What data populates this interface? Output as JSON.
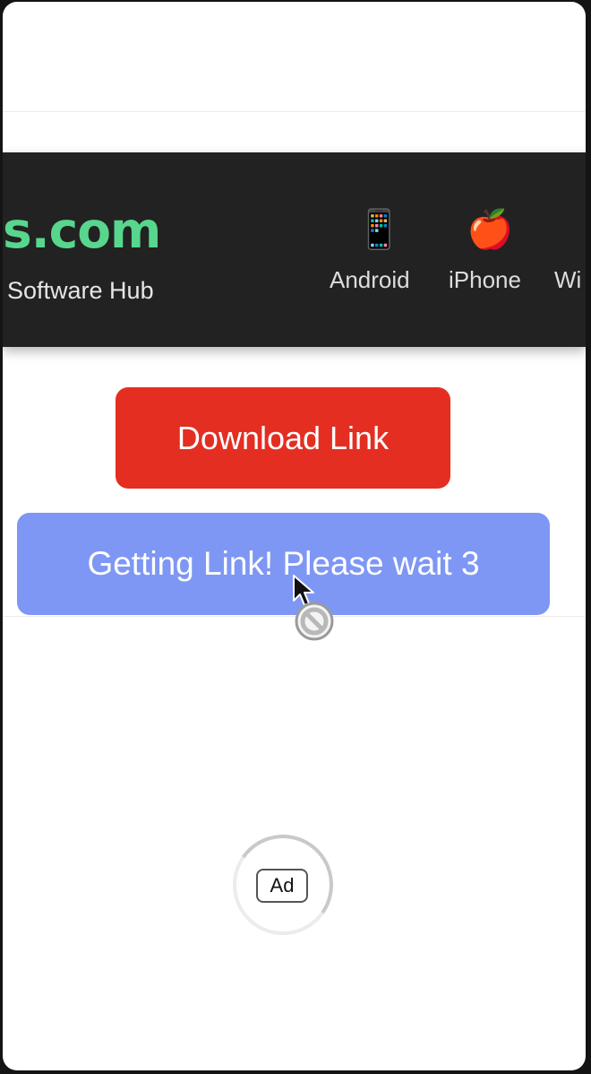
{
  "header": {
    "logo_text": "s.com",
    "tagline": "Software Hub",
    "nav": [
      {
        "icon": "mobile-phone-icon",
        "glyph": "📱",
        "label": "Android"
      },
      {
        "icon": "apple-icon",
        "glyph": "🍎",
        "label": "iPhone"
      },
      {
        "label": "Wi"
      }
    ]
  },
  "main": {
    "download_button": "Download Link",
    "wait_button": "Getting Link! Please wait 3"
  },
  "ad": {
    "badge": "Ad"
  },
  "colors": {
    "header_bg": "#222222",
    "logo": "#58d68d",
    "download_button": "#e42e22",
    "wait_button": "#7e97f4"
  }
}
